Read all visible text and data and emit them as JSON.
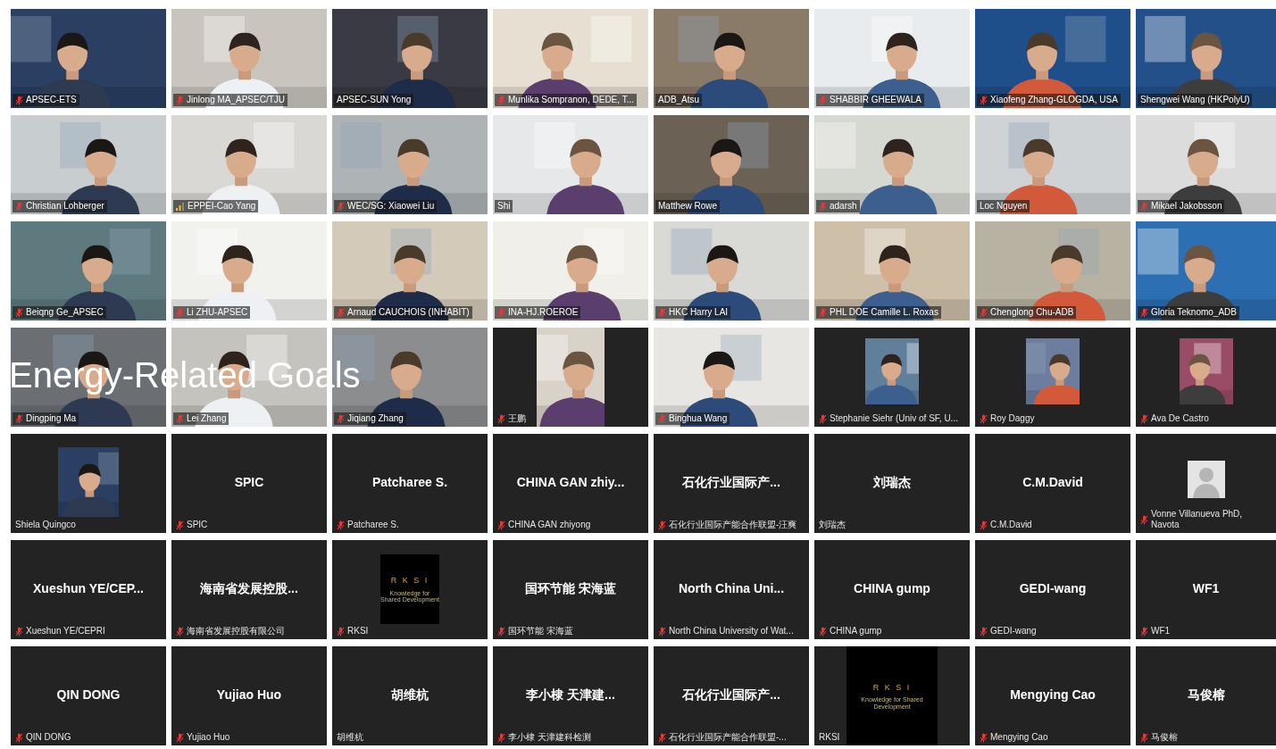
{
  "overlay_caption": "Energy-Related Goals",
  "tiles": [
    {
      "kind": "video",
      "name": "APSEC-ETS",
      "muted": true,
      "unstable_connection": false
    },
    {
      "kind": "video",
      "name": "Jinlong MA_APSEC/TJU",
      "muted": true,
      "unstable_connection": false
    },
    {
      "kind": "video",
      "name": "APSEC-SUN Yong",
      "muted": false,
      "unstable_connection": false
    },
    {
      "kind": "video",
      "name": "Munlika Sompranon, DEDE, T...",
      "muted": true,
      "unstable_connection": false
    },
    {
      "kind": "video",
      "name": "ADB_Atsu",
      "muted": false,
      "unstable_connection": false
    },
    {
      "kind": "video",
      "name": "SHABBIR GHEEWALA",
      "muted": true,
      "unstable_connection": false
    },
    {
      "kind": "video",
      "name": "Xiaofeng Zhang-GLOGDA, USA",
      "muted": true,
      "unstable_connection": false
    },
    {
      "kind": "video",
      "name": "Shengwei Wang (HKPolyU)",
      "muted": false,
      "unstable_connection": false
    },
    {
      "kind": "video",
      "name": "Christian Lohberger",
      "muted": true,
      "unstable_connection": false
    },
    {
      "kind": "video",
      "name": "EPPEI-Cao Yang",
      "muted": false,
      "unstable_connection": true
    },
    {
      "kind": "video",
      "name": "WEC/SG:  Xiaowei Liu",
      "muted": true,
      "unstable_connection": false
    },
    {
      "kind": "video",
      "name": "Shi",
      "muted": false,
      "unstable_connection": false
    },
    {
      "kind": "video",
      "name": "Matthew Rowe",
      "muted": false,
      "unstable_connection": false
    },
    {
      "kind": "video",
      "name": "adarsh",
      "muted": true,
      "unstable_connection": false
    },
    {
      "kind": "video",
      "name": "Loc Nguyen",
      "muted": false,
      "unstable_connection": false
    },
    {
      "kind": "video",
      "name": "Mikael Jakobsson",
      "muted": true,
      "unstable_connection": false
    },
    {
      "kind": "video",
      "name": "Beiqng Ge_APSEC",
      "muted": true,
      "unstable_connection": false
    },
    {
      "kind": "video",
      "name": "Li ZHU-APSEC",
      "muted": true,
      "unstable_connection": false
    },
    {
      "kind": "video",
      "name": "Arnaud CAUCHOIS (INHABIT)",
      "muted": true,
      "unstable_connection": false
    },
    {
      "kind": "video",
      "name": "INA-HJ.ROEROE",
      "muted": true,
      "unstable_connection": false
    },
    {
      "kind": "video",
      "name": "HKC Harry LAI",
      "muted": true,
      "unstable_connection": false
    },
    {
      "kind": "video",
      "name": "PHL DOE Camille L. Roxas",
      "muted": true,
      "unstable_connection": false
    },
    {
      "kind": "video",
      "name": "Chenglong Chu-ADB",
      "muted": true,
      "unstable_connection": false
    },
    {
      "kind": "video",
      "name": "Gloria Teknomo_ADB",
      "muted": true,
      "unstable_connection": false
    },
    {
      "kind": "video",
      "name": "Dingping Ma",
      "muted": true,
      "unstable_connection": false
    },
    {
      "kind": "video",
      "name": "Lei Zhang",
      "muted": true,
      "unstable_connection": false
    },
    {
      "kind": "video",
      "name": "Jiqiang Zhang",
      "muted": true,
      "unstable_connection": false
    },
    {
      "kind": "inset",
      "name": "王鹏",
      "muted": true,
      "unstable_connection": false
    },
    {
      "kind": "video",
      "name": "Binghua Wang",
      "muted": true,
      "unstable_connection": false
    },
    {
      "name": "Stephanie Siehr (Univ of SF, U...",
      "muted": true,
      "unstable_connection": false
    },
    {
      "name": "Roy Daggy",
      "muted": true,
      "unstable_connection": false
    },
    {
      "name": "Ava De Castro",
      "muted": true,
      "unstable_connection": false
    },
    {
      "name": "Shiela Quingco",
      "muted": false,
      "unstable_connection": false
    },
    {
      "kind": "name",
      "display_name": "SPIC",
      "name": "SPIC",
      "muted": true,
      "unstable_connection": false
    },
    {
      "kind": "name",
      "display_name": "Patcharee S.",
      "name": "Patcharee S.",
      "muted": true,
      "unstable_connection": false
    },
    {
      "kind": "name",
      "display_name": "CHINA GAN zhiy...",
      "name": "CHINA GAN zhiyong",
      "muted": true,
      "unstable_connection": false
    },
    {
      "kind": "name",
      "display_name": "石化行业国际产...",
      "name": "石化行业国际产能合作联盟-汪爽",
      "muted": true,
      "unstable_connection": false
    },
    {
      "kind": "name",
      "display_name": "刘瑞杰",
      "name": "刘瑞杰",
      "muted": false,
      "unstable_connection": false
    },
    {
      "kind": "name",
      "display_name": "C.M.David",
      "name": "C.M.David",
      "muted": true,
      "unstable_connection": false
    },
    {
      "kind": "avatar",
      "name": "Vonne Villanueva PhD, Navota",
      "muted": true,
      "unstable_connection": false
    },
    {
      "kind": "name",
      "display_name": "Xueshun YE/CEP...",
      "name": "Xueshun YE/CEPRI",
      "muted": true,
      "unstable_connection": false
    },
    {
      "kind": "name",
      "display_name": "海南省发展控股...",
      "name": "海南省发展控股有限公司",
      "muted": true,
      "unstable_connection": false
    },
    {
      "kind": "logo",
      "logo_text": "R K S I",
      "tagline": "Knowledge for Shared Development",
      "name": "RKSI",
      "muted": true,
      "unstable_connection": false
    },
    {
      "kind": "name",
      "display_name": "国环节能 宋海蓝",
      "name": "国环节能 宋海蓝",
      "muted": true,
      "unstable_connection": false
    },
    {
      "kind": "name",
      "display_name": "North China Uni...",
      "name": "North China University of Wat...",
      "muted": true,
      "unstable_connection": false
    },
    {
      "kind": "name",
      "display_name": "CHINA gump",
      "name": "CHINA gump",
      "muted": true,
      "unstable_connection": false
    },
    {
      "kind": "name",
      "display_name": "GEDI-wang",
      "name": "GEDI-wang",
      "muted": true,
      "unstable_connection": false
    },
    {
      "kind": "name",
      "display_name": "WF1",
      "name": "WF1",
      "muted": true,
      "unstable_connection": false
    },
    {
      "kind": "name",
      "display_name": "QIN DONG",
      "name": "QIN DONG",
      "muted": true,
      "unstable_connection": false
    },
    {
      "kind": "name",
      "display_name": "Yujiao Huo",
      "name": "Yujiao Huo",
      "muted": true,
      "unstable_connection": false
    },
    {
      "kind": "name",
      "display_name": "胡维杭",
      "name": "胡维杭",
      "muted": false,
      "unstable_connection": false
    },
    {
      "kind": "name",
      "display_name": "李小棣  天津建...",
      "name": "李小棣  天津建科检测",
      "muted": true,
      "unstable_connection": false
    },
    {
      "kind": "name",
      "display_name": "石化行业国际产...",
      "name": "石化行业国际产能合作联盟-...",
      "muted": true,
      "unstable_connection": false
    },
    {
      "kind": "logo",
      "logo_text": "R K S I",
      "tagline": "Knowledge for Shared Development",
      "name": "RKSI",
      "muted": false,
      "unstable_connection": false
    },
    {
      "kind": "name",
      "display_name": "Mengying Cao",
      "name": "Mengying Cao",
      "muted": true,
      "unstable_connection": false
    },
    {
      "kind": "name",
      "display_name": "马俊榕",
      "name": "马俊榕",
      "muted": true,
      "unstable_connection": false
    }
  ]
}
